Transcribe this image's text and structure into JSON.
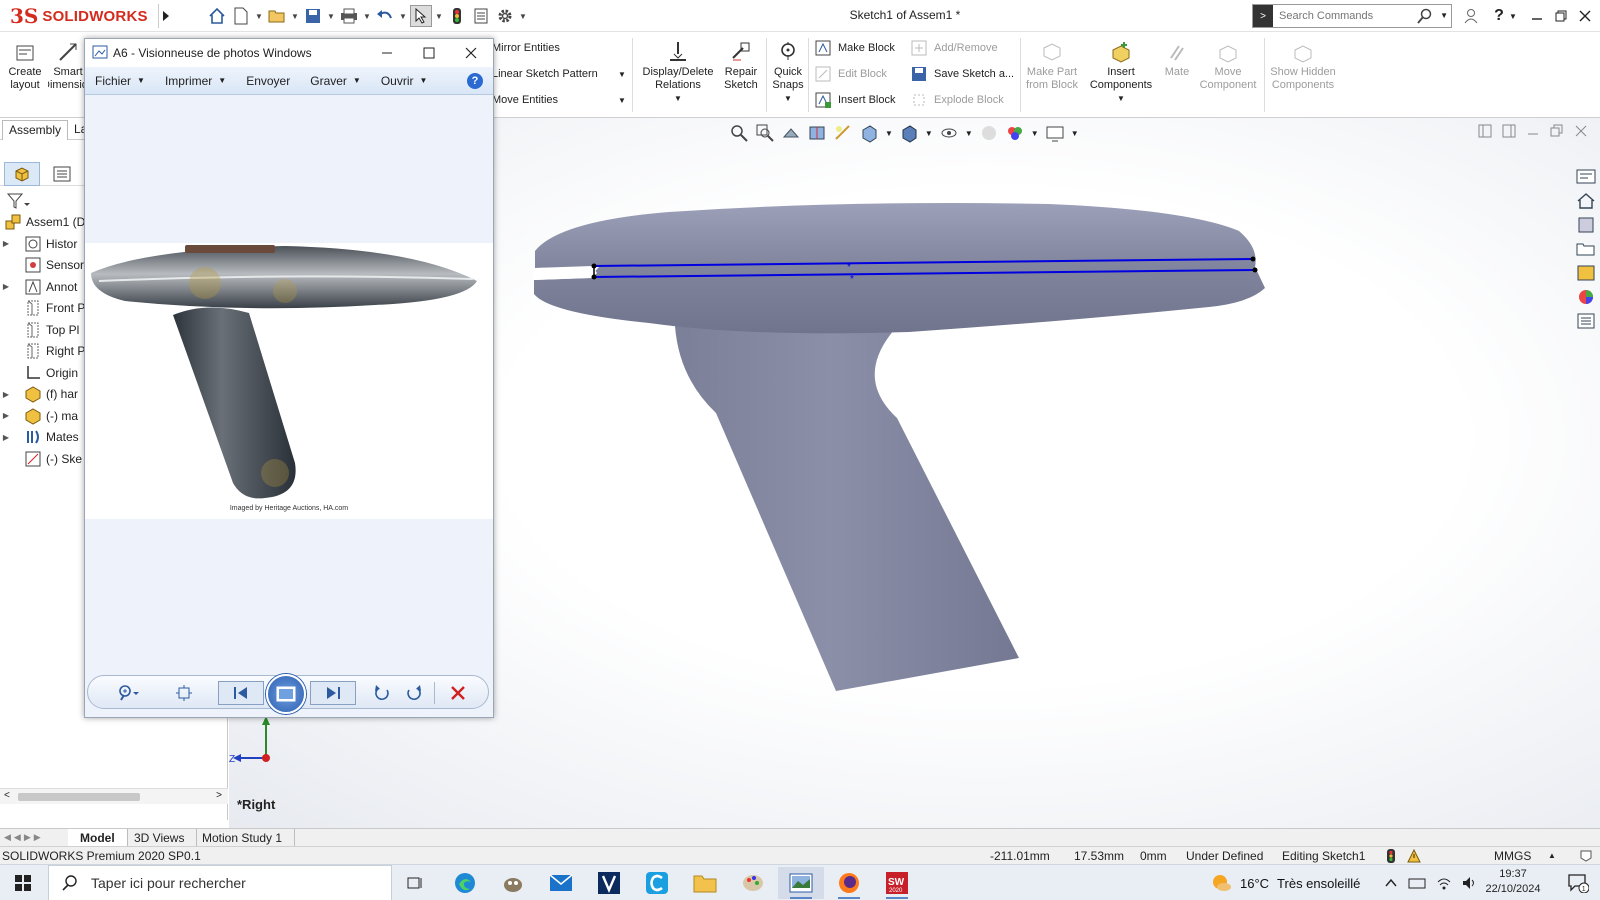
{
  "app": {
    "logo_text": "SOLIDWORKS",
    "document_title": "Sketch1 of Assem1 *",
    "search_placeholder": "Search Commands"
  },
  "ribbon": {
    "create_layout": "Create layout",
    "smart_dim": "Smart Dimension",
    "mirror_entities": "Mirror Entities",
    "linear_pattern": "Linear Sketch Pattern",
    "move_entities": "Move Entities",
    "display_delete_relations": "Display/Delete Relations",
    "repair_sketch": "Repair Sketch",
    "quick_snaps": "Quick Snaps",
    "make_block": "Make Block",
    "edit_block": "Edit Block",
    "insert_block": "Insert Block",
    "add_remove": "Add/Remove",
    "save_sketch": "Save Sketch a...",
    "explode_block": "Explode Block",
    "make_part_from_block": "Make Part from Block",
    "insert_components": "Insert Components",
    "mate": "Mate",
    "move_component": "Move Component",
    "show_hidden_components": "Show Hidden Components"
  },
  "command_tabs": {
    "assembly": "Assembly",
    "layout": "La"
  },
  "feature_tree": {
    "items": [
      {
        "label": "Assem1  (D",
        "icon": "assembly-icon",
        "expander": ""
      },
      {
        "label": "Histor",
        "icon": "history-icon",
        "expander": "▶"
      },
      {
        "label": "Sensor",
        "icon": "sensor-icon",
        "expander": ""
      },
      {
        "label": "Annot",
        "icon": "annotation-icon",
        "expander": "▶"
      },
      {
        "label": "Front P",
        "icon": "plane-icon",
        "expander": ""
      },
      {
        "label": "Top Pl",
        "icon": "plane-icon",
        "expander": ""
      },
      {
        "label": "Right P",
        "icon": "plane-icon",
        "expander": ""
      },
      {
        "label": "Origin",
        "icon": "origin-icon",
        "expander": ""
      },
      {
        "label": "(f) har",
        "icon": "part-icon",
        "expander": "▶"
      },
      {
        "label": "(-) ma",
        "icon": "part-icon",
        "expander": "▶"
      },
      {
        "label": "Mates",
        "icon": "mates-icon",
        "expander": "▶"
      },
      {
        "label": "(-) Ske",
        "icon": "sketch-icon",
        "expander": ""
      }
    ]
  },
  "viewer": {
    "title": "A6 - Visionneuse de photos Windows",
    "menu": [
      "Fichier",
      "Imprimer",
      "Envoyer",
      "Graver",
      "Ouvrir"
    ],
    "help": "?",
    "caption": "Imaged by Heritage Auctions, HA.com"
  },
  "graphics": {
    "view_label": "*Right",
    "axis_y": "Y",
    "axis_z": "Z",
    "model_color": "#8e92aa",
    "sketch_color": "#0000e0"
  },
  "bottom_tabs": [
    "Model",
    "3D Views",
    "Motion Study 1"
  ],
  "status": {
    "product": "SOLIDWORKS Premium 2020 SP0.1",
    "x": "-211.01mm",
    "y": "17.53mm",
    "z": "0mm",
    "definition": "Under Defined",
    "editing": "Editing Sketch1",
    "units": "MMGS"
  },
  "taskbar": {
    "search_placeholder": "Taper ici pour rechercher",
    "weather_temp": "16°C",
    "weather_text": "Très ensoleillé",
    "time": "19:37",
    "date": "22/10/2024",
    "notification_count": "1"
  }
}
